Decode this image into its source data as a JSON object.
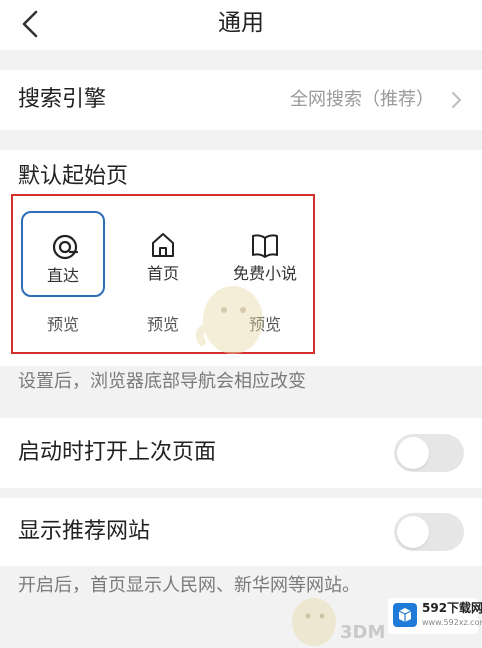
{
  "header": {
    "title": "通用"
  },
  "search_engine": {
    "label": "搜索引擎",
    "value": "全网搜索（推荐）"
  },
  "start_page": {
    "label": "默认起始页",
    "options": [
      {
        "label": "直达",
        "icon": "zhida-icon",
        "selected": true
      },
      {
        "label": "首页",
        "icon": "home-icon",
        "selected": false
      },
      {
        "label": "免费小说",
        "icon": "book-icon",
        "selected": false
      }
    ],
    "preview_label": "预览",
    "hint": "设置后，浏览器底部导航会相应改变"
  },
  "restore_pages": {
    "label": "启动时打开上次页面",
    "enabled": false
  },
  "recommend_sites": {
    "label": "显示推荐网站",
    "enabled": false,
    "hint": "开启后，首页显示人民网、新华网等网站。"
  },
  "watermark": {
    "brand": "592下载网",
    "url": "www.592xz.com",
    "overlay_text": "3DM"
  },
  "colors": {
    "selected_border": "#2f6db8",
    "highlight_box": "#d4302b",
    "toggle_off": "#e6e6e6"
  }
}
